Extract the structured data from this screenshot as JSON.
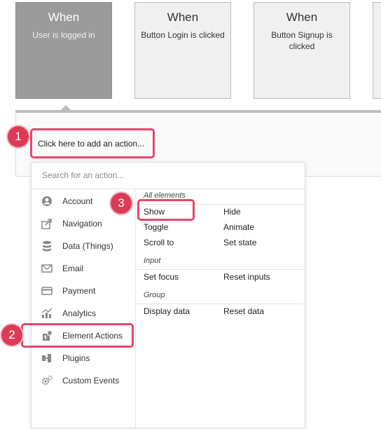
{
  "events": [
    {
      "title": "When",
      "subtitle": "User is logged in"
    },
    {
      "title": "When",
      "subtitle": "Button Login is clicked"
    },
    {
      "title": "When",
      "subtitle": "Button Signup is clicked"
    }
  ],
  "workflow": {
    "add_action_label": "Click here to add an action..."
  },
  "search": {
    "placeholder": "Search for an action..."
  },
  "categories": [
    {
      "label": "Account",
      "icon": "account-icon"
    },
    {
      "label": "Navigation",
      "icon": "navigation-icon"
    },
    {
      "label": "Data (Things)",
      "icon": "database-icon"
    },
    {
      "label": "Email",
      "icon": "email-icon"
    },
    {
      "label": "Payment",
      "icon": "payment-icon"
    },
    {
      "label": "Analytics",
      "icon": "analytics-icon"
    },
    {
      "label": "Element Actions",
      "icon": "element-actions-icon"
    },
    {
      "label": "Plugins",
      "icon": "plugins-icon"
    },
    {
      "label": "Custom Events",
      "icon": "custom-events-icon"
    }
  ],
  "sections": {
    "all_elements": {
      "label": "All elements",
      "actions": [
        "Show",
        "Hide",
        "Toggle",
        "Animate",
        "Scroll to",
        "Set state"
      ]
    },
    "input": {
      "label": "Input",
      "actions": [
        "Set focus",
        "Reset inputs"
      ]
    },
    "group": {
      "label": "Group",
      "actions": [
        "Display data",
        "Reset data"
      ]
    }
  },
  "badges": [
    "1",
    "2",
    "3"
  ],
  "colors": {
    "highlight": "#e8466a",
    "badge": "#dc3b56",
    "active_event": "#9b9b9b"
  }
}
